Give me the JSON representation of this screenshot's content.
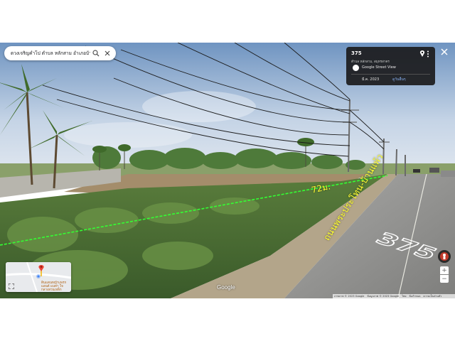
{
  "search": {
    "value": "ดวงเจริญคำโป ตำบล หลักสาม อำเภอบ้าน"
  },
  "info_card": {
    "title": "375",
    "subtitle": "ตำบล หลักสาม, สมุทรสาคร",
    "provider": "Google Street View",
    "date": "มี.ค. 2023",
    "more_dates_label": "ดูวันอื่นๆ"
  },
  "road_shield_text": "375",
  "overlay": {
    "measure_text": "72ม.",
    "road_name_text": "ถนนพระประโทน-บ้านแพ้ว",
    "measure_line_color": "#33ff33",
    "text_color": "#ffff33"
  },
  "map_thumbnail": {
    "label": "ดินแดนหญ้าแพรกแอนด์ แนท่า ใจ กลางสวนเหล็ก"
  },
  "logo": "Google",
  "footer": {
    "imagery": "ภาพภาพ © 2023 Google",
    "attribution": "ข้อมูลภาพ © 2023 Google",
    "terms": "ไทย",
    "privacy": "ข้อกำหนด",
    "report": "ความเป็นส่วนตัว"
  },
  "controls": {
    "zoom_in": "+",
    "zoom_out": "−"
  },
  "colors": {
    "sky_top": "#7a9fc7",
    "sky_bottom": "#dfe6ef",
    "road": "#8f8f8f",
    "grass": "#4a6d35"
  }
}
